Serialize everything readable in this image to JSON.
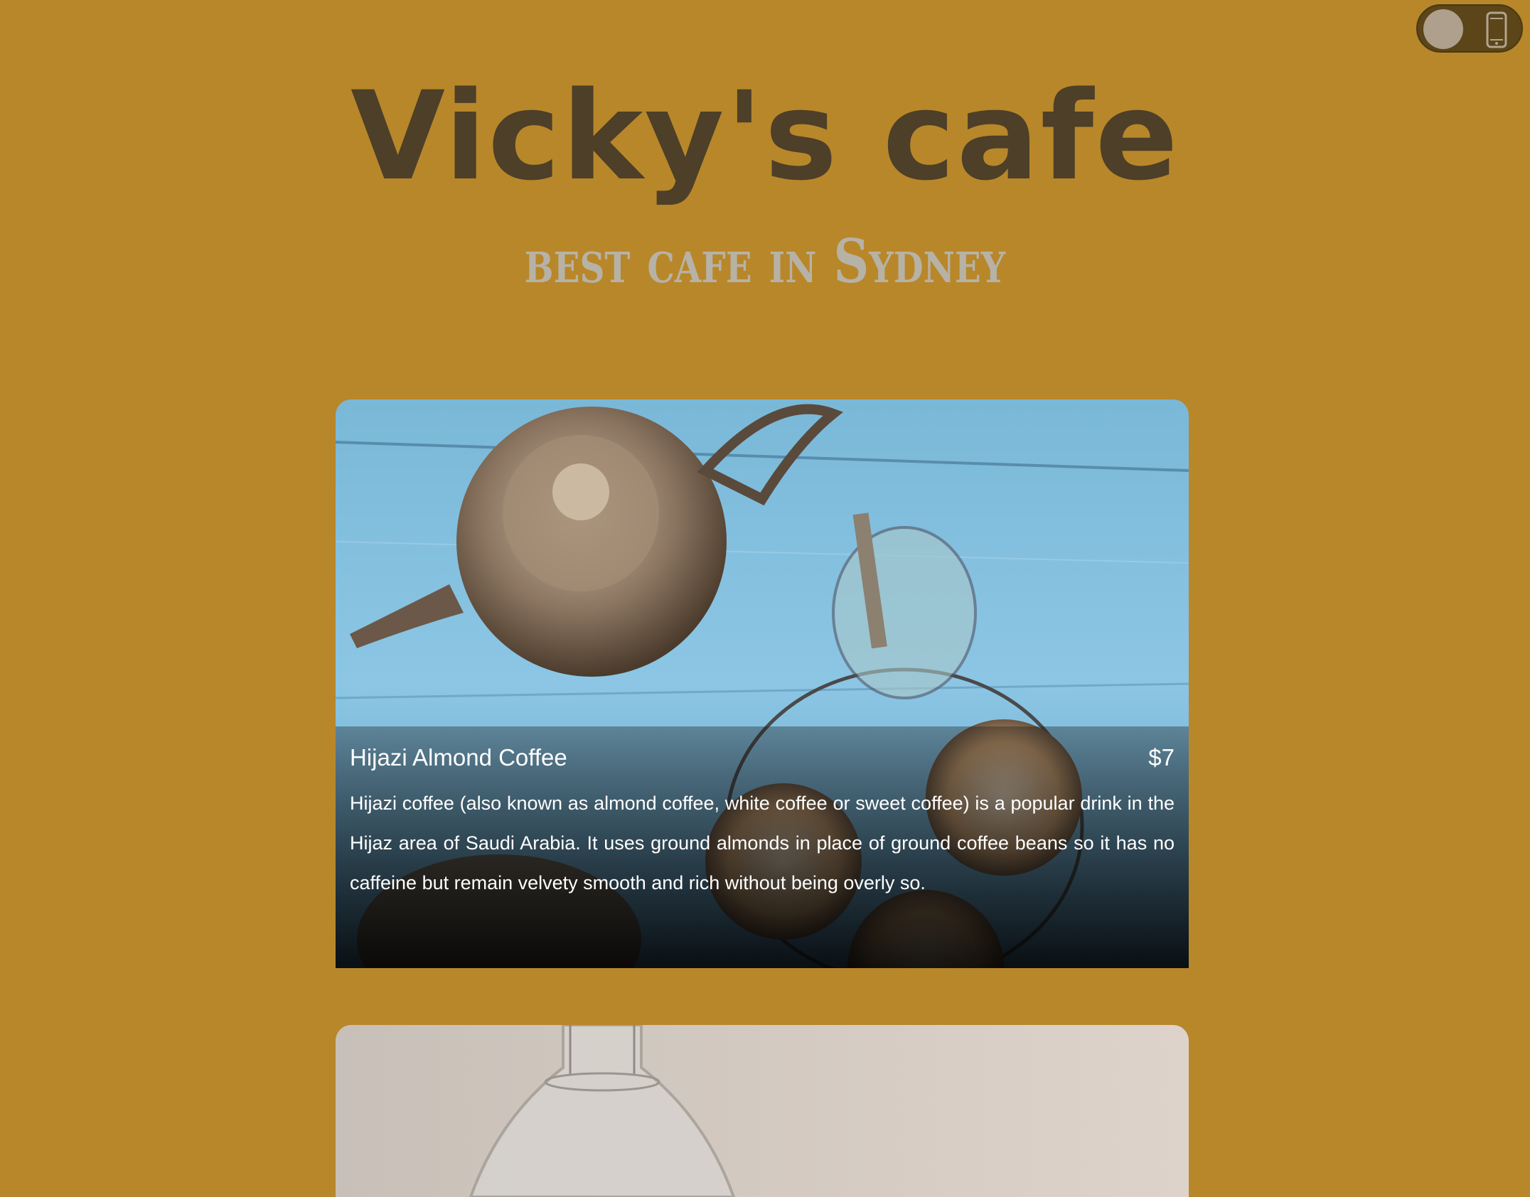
{
  "header": {
    "title": "Vicky's cafe",
    "subtitle": "best cafe in Sydney"
  },
  "toggle": {
    "icon": "phone-icon",
    "state": "off"
  },
  "menu_items": [
    {
      "name": "Hijazi Almond Coffee",
      "price": "$7",
      "description": "Hijazi coffee (also known as almond coffee, white coffee or sweet coffee) is a popular drink in the Hijaz area of Saudi Arabia. It uses ground almonds in place of ground coffee beans so it has no caffeine but remain velvety smooth and rich without being overly so."
    }
  ],
  "colors": {
    "background": "#b8872a",
    "title": "#4d3f28",
    "subtitle": "#b7b2a6"
  }
}
